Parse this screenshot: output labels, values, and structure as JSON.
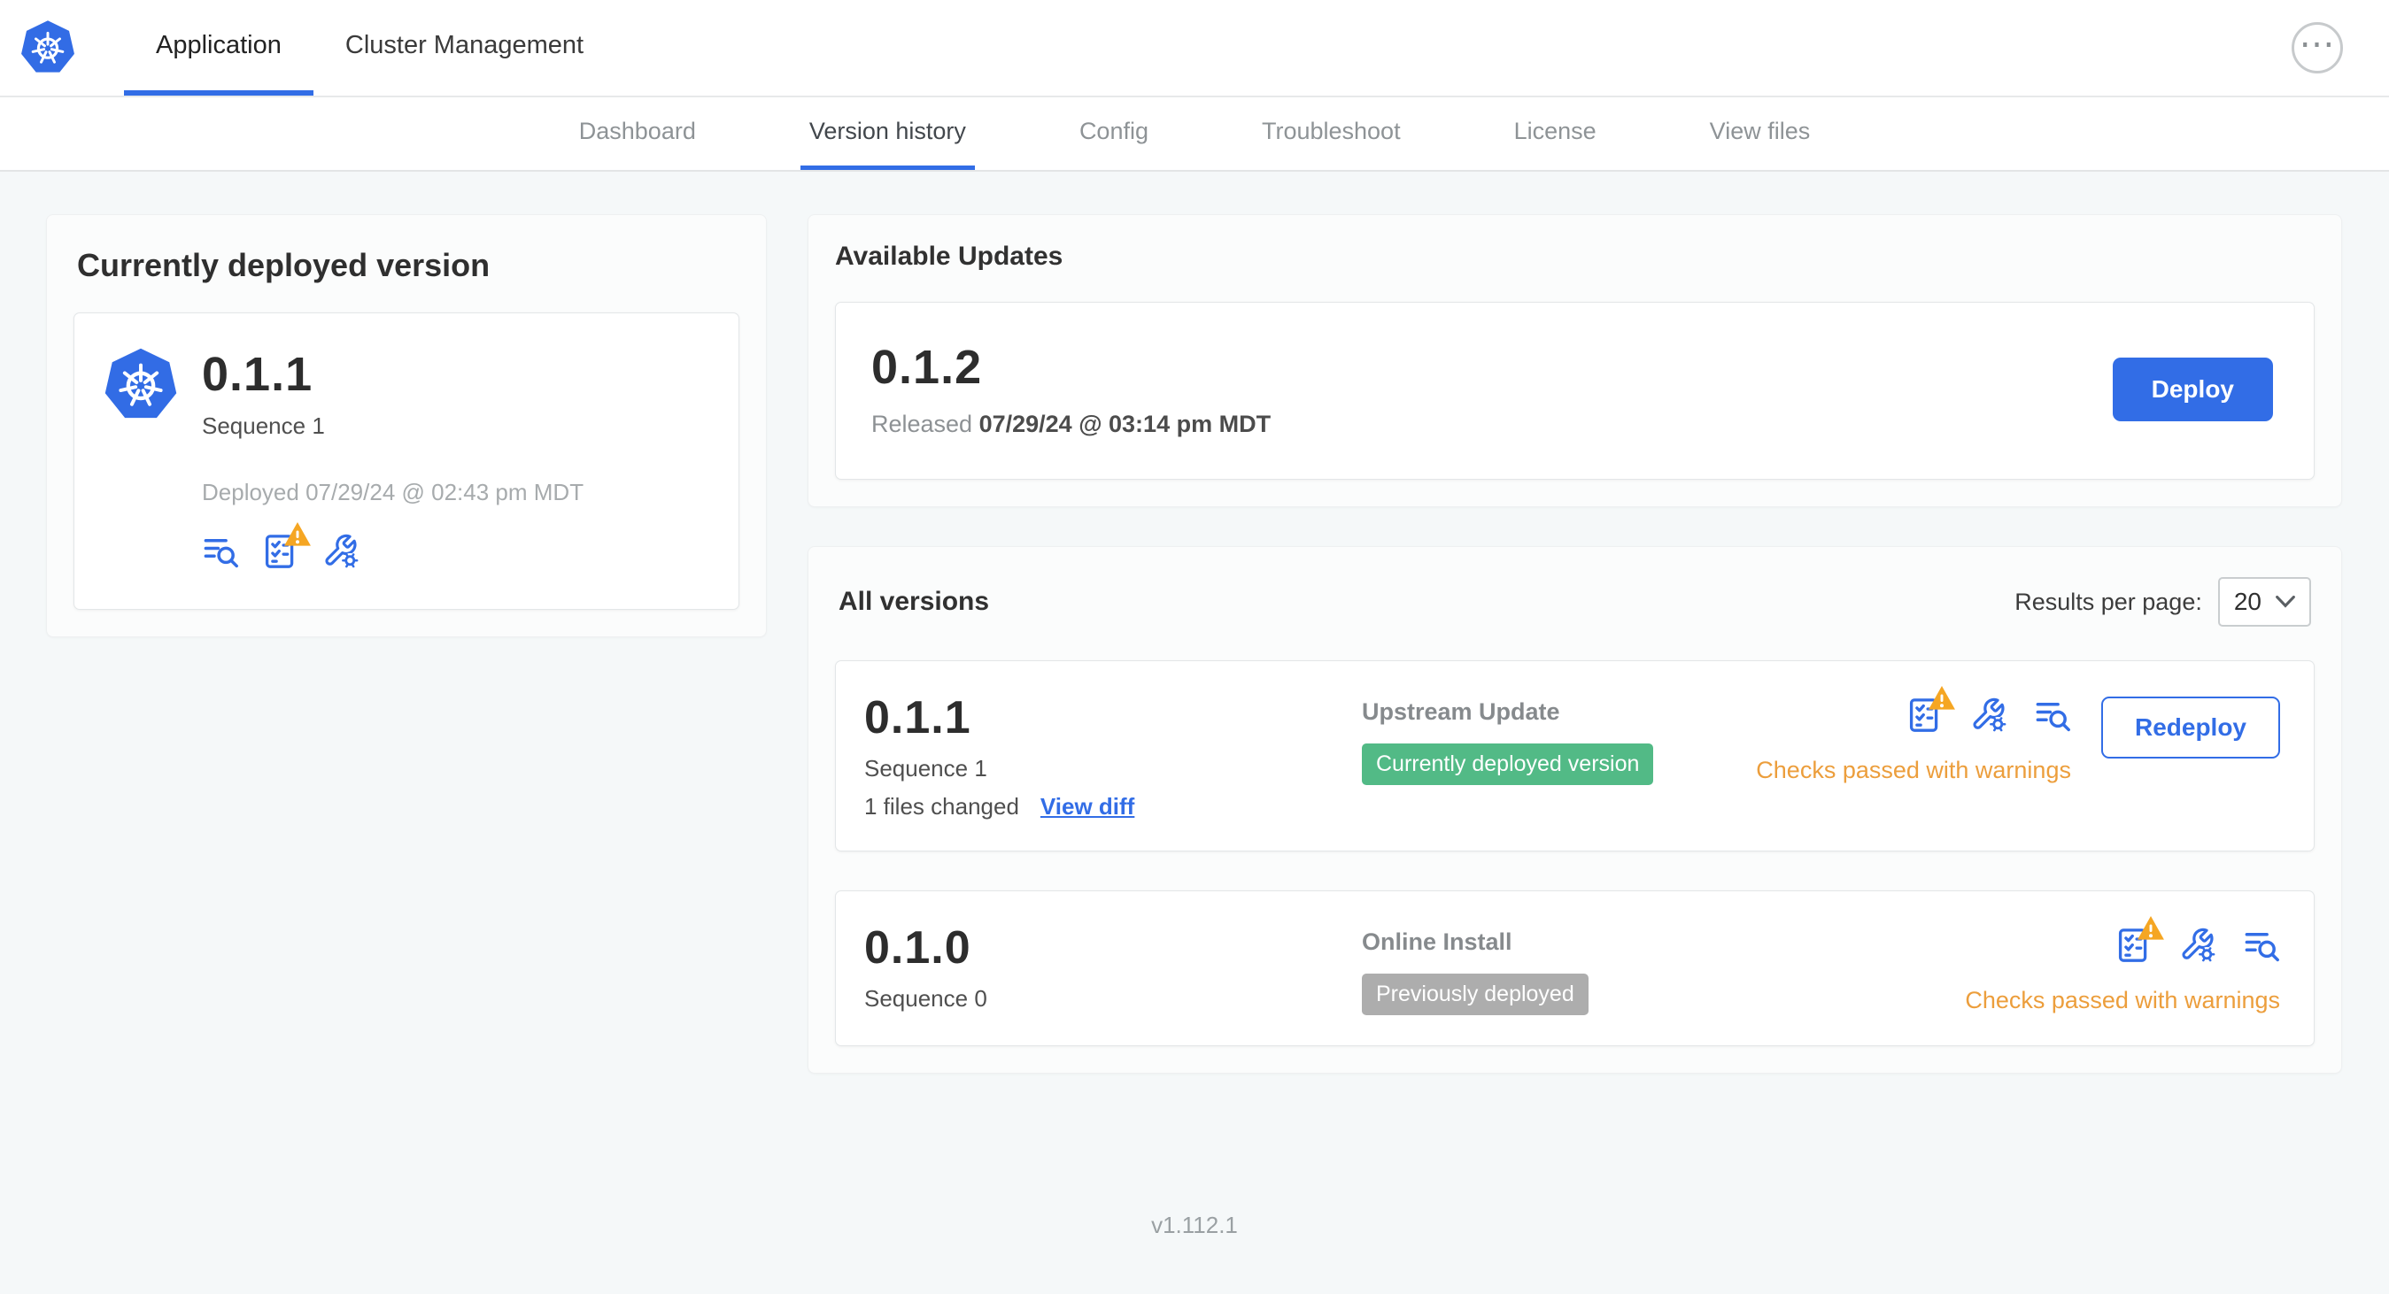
{
  "colors": {
    "accent": "#326DE6",
    "logo": "#326CE5",
    "badge_green": "#52BA86",
    "badge_gray": "#ADADAD",
    "warn_text": "#EC9E3C",
    "warn_tri": "#F5A623"
  },
  "header": {
    "tabs": [
      {
        "label": "Application",
        "active": true
      },
      {
        "label": "Cluster Management",
        "active": false
      }
    ]
  },
  "subnav": {
    "tabs": [
      {
        "label": "Dashboard",
        "active": false
      },
      {
        "label": "Version history",
        "active": true
      },
      {
        "label": "Config",
        "active": false
      },
      {
        "label": "Troubleshoot",
        "active": false
      },
      {
        "label": "License",
        "active": false
      },
      {
        "label": "View files",
        "active": false
      }
    ]
  },
  "current_version": {
    "title": "Currently deployed version",
    "version": "0.1.1",
    "sequence": "Sequence 1",
    "deployed": "Deployed 07/29/24 @ 02:43 pm MDT"
  },
  "available_updates": {
    "title": "Available Updates",
    "version": "0.1.2",
    "released_label": "Released",
    "released_date": "07/29/24 @ 03:14 pm MDT",
    "deploy_button": "Deploy"
  },
  "all_versions": {
    "title": "All versions",
    "results_per_page_label": "Results per page:",
    "results_per_page_value": "20",
    "rows": [
      {
        "version": "0.1.1",
        "sequence": "Sequence 1",
        "files_changed": "1 files changed",
        "view_diff": "View diff",
        "source": "Upstream Update",
        "badge": "Currently deployed version",
        "status": "Checks passed with warnings",
        "action": "Redeploy"
      },
      {
        "version": "0.1.0",
        "sequence": "Sequence 0",
        "source": "Online Install",
        "badge": "Previously deployed",
        "status": "Checks passed with warnings"
      }
    ]
  },
  "footer": {
    "app_version": "v1.112.1"
  }
}
